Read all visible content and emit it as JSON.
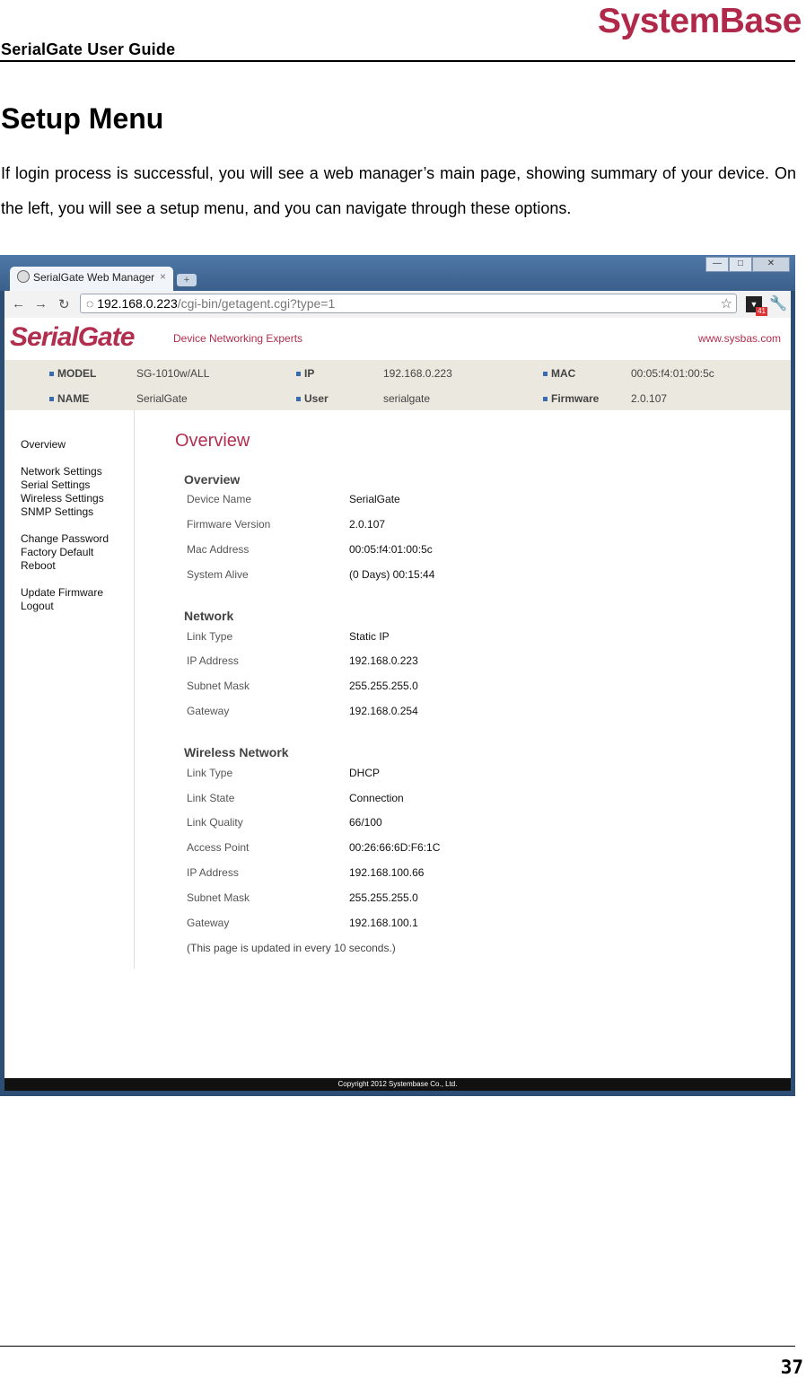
{
  "doc": {
    "title": "SerialGate User Guide",
    "logo": "SystemBase",
    "heading": "Setup Menu",
    "intro": "If login process is successful, you will see a web manager’s main page, showing summary of your device. On the left, you will see a setup menu, and you can navigate through these options.",
    "page_number": "37"
  },
  "browser": {
    "tab_title": "SerialGate Web Manager",
    "tab_close": "×",
    "url_host": "192.168.0.223",
    "url_path": "/cgi-bin/getagent.cgi?type=1",
    "badge": "41"
  },
  "app": {
    "brand": "SerialGate",
    "tagline": "Device Networking Experts",
    "site": "www.sysbas.com",
    "info": {
      "model_label": "MODEL",
      "model": "SG-1010w/ALL",
      "ip_label": "IP",
      "ip": "192.168.0.223",
      "mac_label": "MAC",
      "mac": "00:05:f4:01:00:5c",
      "name_label": "NAME",
      "name": "SerialGate",
      "user_label": "User",
      "user": "serialgate",
      "firmware_label": "Firmware",
      "firmware": "2.0.107"
    },
    "menu": {
      "overview": "Overview",
      "network": "Network Settings",
      "serial": "Serial Settings",
      "wireless": "Wireless Settings",
      "snmp": "SNMP Settings",
      "password": "Change Password",
      "factory": "Factory Default",
      "reboot": "Reboot",
      "update": "Update Firmware",
      "logout": "Logout"
    },
    "content_title": "Overview",
    "overview": {
      "title": "Overview",
      "rows": [
        {
          "label": "Device Name",
          "value": "SerialGate"
        },
        {
          "label": "Firmware Version",
          "value": "2.0.107"
        },
        {
          "label": "Mac Address",
          "value": "00:05:f4:01:00:5c"
        },
        {
          "label": "System Alive",
          "value": "(0 Days) 00:15:44"
        }
      ]
    },
    "network": {
      "title": "Network",
      "rows": [
        {
          "label": "Link Type",
          "value": "Static IP"
        },
        {
          "label": "IP Address",
          "value": "192.168.0.223"
        },
        {
          "label": "Subnet Mask",
          "value": "255.255.255.0"
        },
        {
          "label": "Gateway",
          "value": "192.168.0.254"
        }
      ]
    },
    "wireless": {
      "title": "Wireless Network",
      "rows": [
        {
          "label": "Link Type",
          "value": "DHCP"
        },
        {
          "label": "Link State",
          "value": "Connection"
        },
        {
          "label": "Link Quality",
          "value": "66/100"
        },
        {
          "label": "Access Point",
          "value": "00:26:66:6D:F6:1C"
        },
        {
          "label": "IP Address",
          "value": "192.168.100.66"
        },
        {
          "label": "Subnet Mask",
          "value": "255.255.255.0"
        },
        {
          "label": "Gateway",
          "value": "192.168.100.1"
        }
      ]
    },
    "note": "(This page is updated in every 10 seconds.)",
    "copyright": "Copyright 2012 Systembase Co., Ltd."
  }
}
